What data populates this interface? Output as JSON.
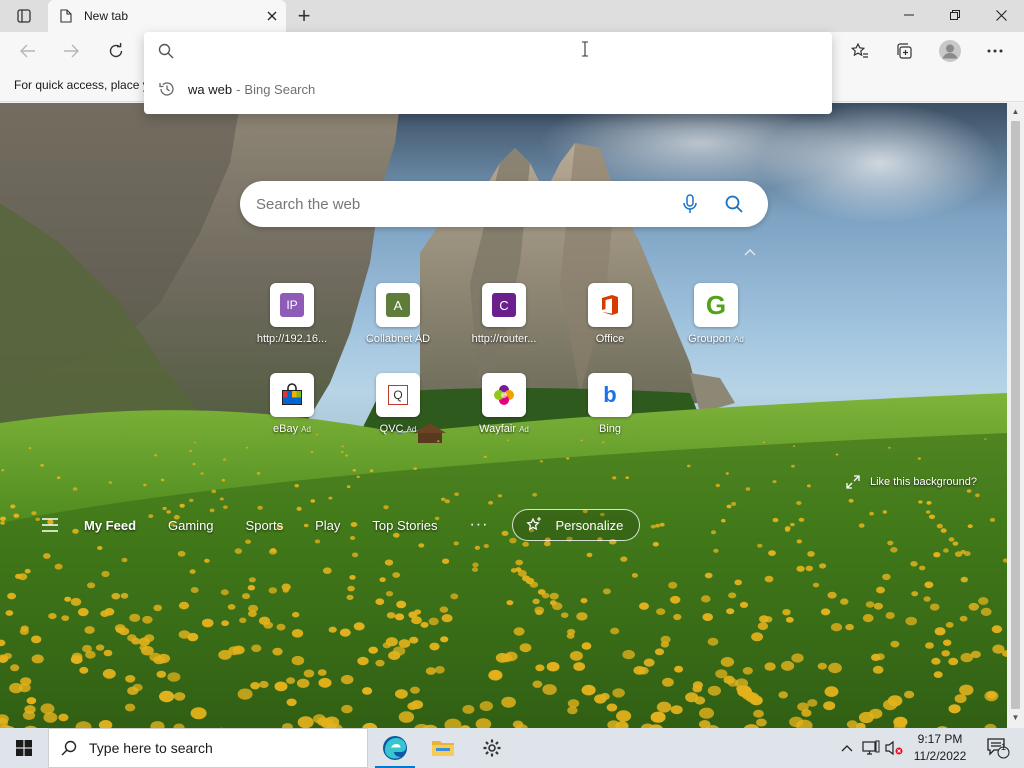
{
  "browser": {
    "tab": {
      "title": "New tab"
    },
    "new_tab_symbol": "+",
    "favorites_bar_message": "For quick access, place y"
  },
  "omnibox": {
    "value": "",
    "suggestion": {
      "query": "wa web",
      "separator": "-",
      "source": "Bing Search"
    }
  },
  "newtab": {
    "search_placeholder": "Search the web",
    "tiles": [
      {
        "label": "http://192.16...",
        "ad": "",
        "icon": "ip-icon",
        "icon_text": "IP",
        "color": "#8e5bb7"
      },
      {
        "label": "Collabnet AD",
        "ad": "",
        "icon": "collabnet-icon",
        "icon_text": "A",
        "color": "#5e7d3b"
      },
      {
        "label": "http://router...",
        "ad": "",
        "icon": "router-icon",
        "icon_text": "C",
        "color": "#6a1f8c"
      },
      {
        "label": "Office",
        "ad": "",
        "icon": "office-icon",
        "icon_text": "",
        "color": "#d83b01"
      },
      {
        "label": "Groupon",
        "ad": "Ad",
        "icon": "groupon-icon",
        "icon_text": "G",
        "color": "#53a318"
      },
      {
        "label": "eBay",
        "ad": "Ad",
        "icon": "ebay-icon",
        "icon_text": "",
        "color": "#e53238"
      },
      {
        "label": "QVC",
        "ad": "Ad",
        "icon": "qvc-icon",
        "icon_text": "Q",
        "color": "#c0392b"
      },
      {
        "label": "Wayfair",
        "ad": "Ad",
        "icon": "wayfair-icon",
        "icon_text": "",
        "color": "#7b189f"
      },
      {
        "label": "Bing",
        "ad": "",
        "icon": "bing-icon",
        "icon_text": "b",
        "color": "#1a73e8"
      }
    ],
    "like_background": "Like this background?",
    "feed_nav": [
      "My Feed",
      "Gaming",
      "Sports",
      "Play",
      "Top Stories"
    ],
    "more_symbol": "···",
    "personalize": "Personalize"
  },
  "taskbar": {
    "search_placeholder": "Type here to search",
    "time": "9:17 PM",
    "date": "11/2/2022",
    "notification_count": "1"
  },
  "colors": {
    "accent": "#0078d4",
    "tabbar": "#dedede",
    "toolbar": "#f7f7f7"
  }
}
